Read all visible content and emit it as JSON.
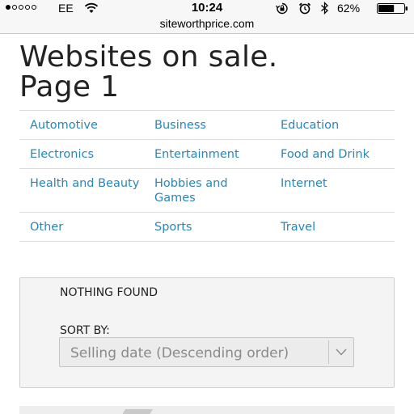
{
  "status_bar": {
    "carrier": "EE",
    "time": "10:24",
    "battery_percent": "62%",
    "signal_bars_filled": 1,
    "signal_bars_total": 5,
    "battery_level": 0.62,
    "icons": [
      "signal-dots-icon",
      "wifi-icon",
      "rotation-lock-icon",
      "alarm-icon",
      "bluetooth-icon",
      "battery-icon"
    ]
  },
  "url_bar": {
    "url": "siteworthprice.com"
  },
  "page": {
    "title_line1": "Websites on sale.",
    "title_line2": "Page 1"
  },
  "categories": [
    [
      "Automotive",
      "Business",
      "Education"
    ],
    [
      "Electronics",
      "Entertainment",
      "Food and Drink"
    ],
    [
      "Health and Beauty",
      "Hobbies and Games",
      "Internet"
    ],
    [
      "Other",
      "Sports",
      "Travel"
    ]
  ],
  "results": {
    "message": "NOTHING FOUND",
    "sort_label": "SORT BY:",
    "sort_value": "Selling date (Descending order)"
  },
  "colors": {
    "link": "#2a85b9",
    "text": "#222222",
    "panel_bg": "#f4f4f4",
    "select_bg": "#ececec"
  }
}
